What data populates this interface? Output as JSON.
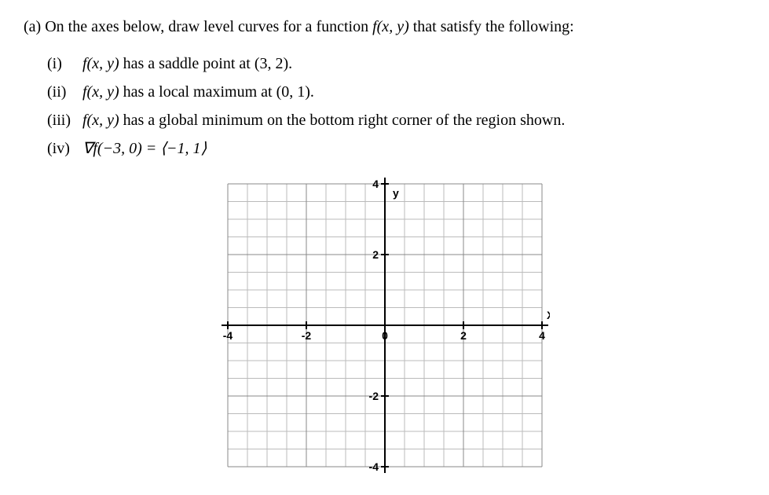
{
  "question": {
    "part_label": "(a)",
    "prompt_before": "On the axes below, draw level curves for a function ",
    "prompt_func": "f(x, y)",
    "prompt_after": " that satisfy the following:"
  },
  "items": [
    {
      "roman": "(i)",
      "text_before": "f(x, y)",
      "text_mid": " has a saddle point at ",
      "point": "(3, 2)",
      "text_after": "."
    },
    {
      "roman": "(ii)",
      "text_before": "f(x, y)",
      "text_mid": " has a local maximum at ",
      "point": "(0, 1)",
      "text_after": "."
    },
    {
      "roman": "(iii)",
      "text_before": "f(x, y)",
      "text_mid": " has a global minimum on the bottom right corner of the region shown.",
      "point": "",
      "text_after": ""
    },
    {
      "roman": "(iv)",
      "text_before": "∇f(−3, 0) = ⟨−1, 1⟩",
      "text_mid": "",
      "point": "",
      "text_after": ""
    }
  ],
  "chart_data": {
    "type": "grid",
    "xlabel": "X",
    "ylabel": "y",
    "xlim": [
      -4,
      4
    ],
    "ylim": [
      -4,
      4
    ],
    "x_ticks": [
      -4,
      -2,
      0,
      2,
      4
    ],
    "y_ticks": [
      -4,
      -2,
      2,
      4
    ],
    "x_tick_labels": [
      "-4",
      "-2",
      "0",
      "2",
      "4"
    ],
    "y_tick_labels": [
      "-4",
      "-2",
      "2",
      "4"
    ],
    "minor_grid_step": 0.5,
    "major_grid_step": 2
  }
}
